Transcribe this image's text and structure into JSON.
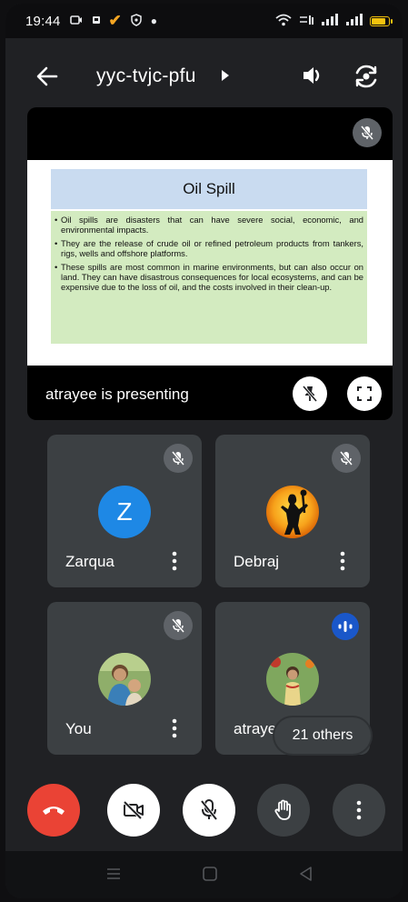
{
  "status_bar": {
    "time": "19:44"
  },
  "header": {
    "meeting_code": "yyc-tvjc-pfu"
  },
  "presentation": {
    "slide_title": "Oil Spill",
    "bullets": [
      "Oil spills are disasters that can have severe social, economic, and environmental impacts.",
      "They are the release of crude oil or refined petroleum products from tankers, rigs, wells and offshore platforms.",
      "These spills are most common in marine environments, but can also occur on land. They can have disastrous consequences for local ecosystems, and can be expensive due to the loss of oil, and the costs involved in their clean-up."
    ],
    "presenting_label": "atrayee is presenting"
  },
  "participants": [
    {
      "name": "Zarqua",
      "initial": "Z",
      "avatar_color": "#1e88e5",
      "muted": true
    },
    {
      "name": "Debraj",
      "muted": true
    },
    {
      "name": "You",
      "muted": true
    },
    {
      "name": "atraye",
      "speaking": true
    }
  ],
  "others_chip": "21 others",
  "colors": {
    "end_call": "#ea4335",
    "speaking": "#1a57c9",
    "tile": "#3c4043"
  }
}
